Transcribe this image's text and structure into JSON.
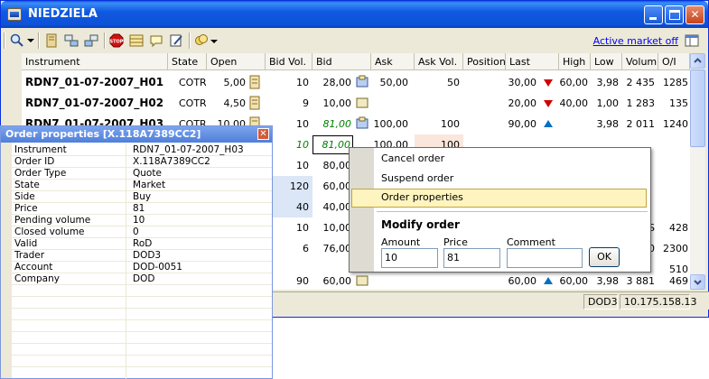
{
  "window": {
    "title": "NIEDZIELA"
  },
  "toolbar": {
    "active_market_link": "Active market off",
    "icons": [
      "zoom-icon",
      "dropdown-arrow-icon",
      "book-icon",
      "swap-left-icon",
      "swap-right-icon",
      "stop-icon",
      "table-icon",
      "comment-icon",
      "edit-icon",
      "coins-icon",
      "layout-icon"
    ]
  },
  "grid": {
    "columns": [
      "Instrument",
      "State",
      "Open",
      "Bid Vol.",
      "Bid",
      "Ask",
      "Ask Vol.",
      "Position",
      "Last",
      "High",
      "Low",
      "Volum",
      "O/I"
    ],
    "rows": [
      {
        "instrument": "RDN7_01-07-2007_H01",
        "state": "COTR",
        "open": "5,00",
        "bidvol": "10",
        "bid": "28,00",
        "ask": "50,00",
        "askvol": "50",
        "position": "",
        "last": "30,00",
        "trend": "down",
        "high": "60,00",
        "low": "3,98",
        "volume": "2 435",
        "oi": "1285"
      },
      {
        "instrument": "RDN7_01-07-2007_H02",
        "state": "COTR",
        "open": "4,50",
        "bidvol": "9",
        "bid": "10,00",
        "ask": "",
        "askvol": "",
        "position": "",
        "last": "20,00",
        "trend": "down",
        "high": "40,00",
        "low": "1,00",
        "volume": "1 283",
        "oi": "135"
      },
      {
        "instrument": "RDN7_01-07-2007_H03",
        "state": "COTR",
        "open": "10,00",
        "bidvol": "10",
        "bid": "81,00",
        "ask": "100,00",
        "askvol": "100",
        "position": "",
        "last": "90,00",
        "trend": "up",
        "high": "",
        "low": "3,98",
        "volume": "2 011",
        "oi": "1240"
      },
      {
        "instrument": "",
        "state": "",
        "open": "",
        "bidvol": "10",
        "bid": "81,00",
        "ask": "100,00",
        "askvol": "100",
        "position": "",
        "last": "",
        "trend": "",
        "high": "",
        "low": "",
        "volume": "",
        "oi": ""
      },
      {
        "instrument": "",
        "state": "",
        "open": "",
        "bidvol": "10",
        "bid": "80,00",
        "ask": "",
        "askvol": "",
        "position": "",
        "last": "",
        "trend": "",
        "high": "",
        "low": "",
        "volume": "",
        "oi": ""
      },
      {
        "instrument": "",
        "state": "",
        "open": "",
        "bidvol": "120",
        "bid": "60,00",
        "ask": "",
        "askvol": "",
        "position": "",
        "last": "",
        "trend": "",
        "high": "",
        "low": "",
        "volume": "",
        "oi": ""
      },
      {
        "instrument": "",
        "state": "",
        "open": "",
        "bidvol": "40",
        "bid": "40,00",
        "ask": "",
        "askvol": "",
        "position": "",
        "last": "",
        "trend": "",
        "high": "",
        "low": "",
        "volume": "",
        "oi": ""
      },
      {
        "instrument": "",
        "state": "",
        "open": "",
        "bidvol": "10",
        "bid": "10,00",
        "ask": "",
        "askvol": "",
        "position": "",
        "last": "",
        "trend": "",
        "high": "",
        "low": "",
        "volume": "S",
        "oi": "428"
      },
      {
        "instrument": "",
        "state": "",
        "open": "",
        "bidvol": "6",
        "bid": "76,00",
        "ask": "",
        "askvol": "",
        "position": "",
        "last": "",
        "trend": "",
        "high": "",
        "low": "",
        "volume": "0",
        "oi": "2300"
      },
      {
        "instrument": "",
        "state": "",
        "open": "",
        "bidvol": "",
        "bid": "",
        "ask": "",
        "askvol": "",
        "position": "",
        "last": "",
        "trend": "",
        "high": "",
        "low": "",
        "volume": "",
        "oi": "510"
      },
      {
        "instrument": "",
        "state": "",
        "open": "",
        "bidvol": "90",
        "bid": "60,00",
        "ask": "",
        "askvol": "",
        "position": "",
        "last": "60,00",
        "trend": "up",
        "high": "60,00",
        "low": "3,98",
        "volume": "3 881",
        "oi": "469"
      }
    ]
  },
  "status": {
    "user": "DOD3",
    "ip": "10.175.158.13"
  },
  "properties": {
    "title": "Order properties [X.118A7389CC2]",
    "items": [
      {
        "name": "Instrument",
        "value": "RDN7_01-07-2007_H03"
      },
      {
        "name": "Order ID",
        "value": "X.118A7389CC2"
      },
      {
        "name": "Order Type",
        "value": "Quote"
      },
      {
        "name": "State",
        "value": "Market"
      },
      {
        "name": "Side",
        "value": "Buy"
      },
      {
        "name": "Price",
        "value": "81"
      },
      {
        "name": "Pending volume",
        "value": "10"
      },
      {
        "name": "Closed volume",
        "value": "0"
      },
      {
        "name": "Valid",
        "value": "RoD"
      },
      {
        "name": "Trader",
        "value": "DOD3"
      },
      {
        "name": "Account",
        "value": "DOD-0051"
      },
      {
        "name": "Company",
        "value": "DOD"
      }
    ]
  },
  "context_menu": {
    "items": [
      "Cancel order",
      "Suspend order",
      "Order properties"
    ],
    "modify_heading": "Modify order",
    "amount_label": "Amount",
    "price_label": "Price",
    "comment_label": "Comment",
    "amount_value": "10",
    "price_value": "81",
    "comment_value": "",
    "ok_label": "OK"
  },
  "colors": {
    "title_blue": "#0a5fe7",
    "bid_green": "#008000",
    "down_red": "#d00000",
    "up_blue": "#0070c0",
    "highlight": "#fdf4bf"
  }
}
